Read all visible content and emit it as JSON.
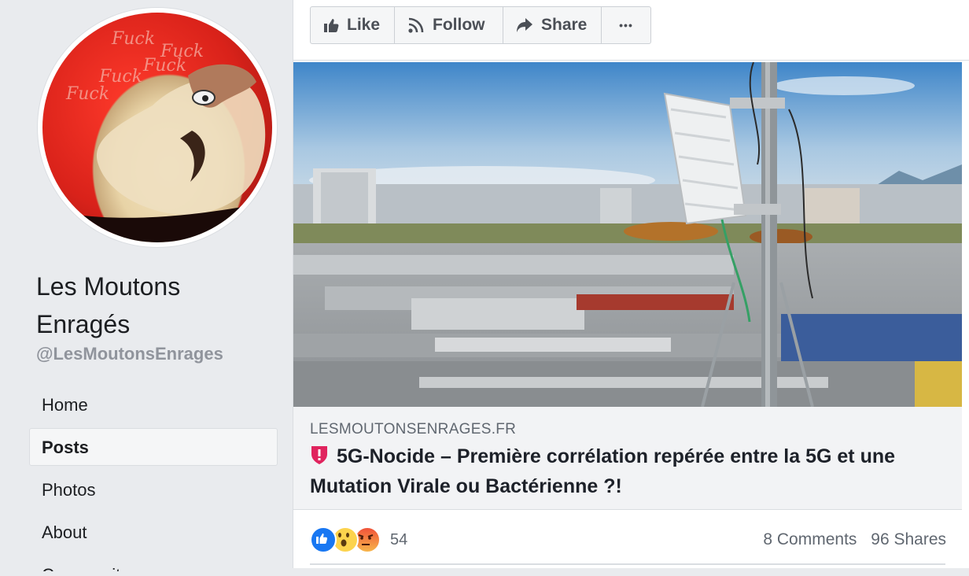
{
  "page": {
    "name": "Les Moutons Enragés",
    "handle": "@LesMoutonsEnrages",
    "avatar_words": [
      "Fuck",
      "Fuck",
      "Fuck",
      "Fuck",
      "Fuck"
    ]
  },
  "nav": {
    "items": [
      {
        "label": "Home",
        "active": false
      },
      {
        "label": "Posts",
        "active": true
      },
      {
        "label": "Photos",
        "active": false
      },
      {
        "label": "About",
        "active": false
      },
      {
        "label": "Community",
        "active": false
      }
    ]
  },
  "toolbar": {
    "like_label": "Like",
    "follow_label": "Follow",
    "share_label": "Share",
    "more_label": "•••"
  },
  "post": {
    "link_domain": "LESMOUTONSENRAGES.FR",
    "link_title": "5G-Nocide – Première corrélation repérée entre la 5G et une Mutation Virale ou Bactérienne ?!",
    "reaction_count": "54",
    "comments": "8 Comments",
    "shares": "96 Shares"
  },
  "colors": {
    "facebook_blue": "#1877f2",
    "shield_red": "#e0245e",
    "angry_orange": "#f0533a",
    "wow_yellow": "#fcd34d"
  }
}
